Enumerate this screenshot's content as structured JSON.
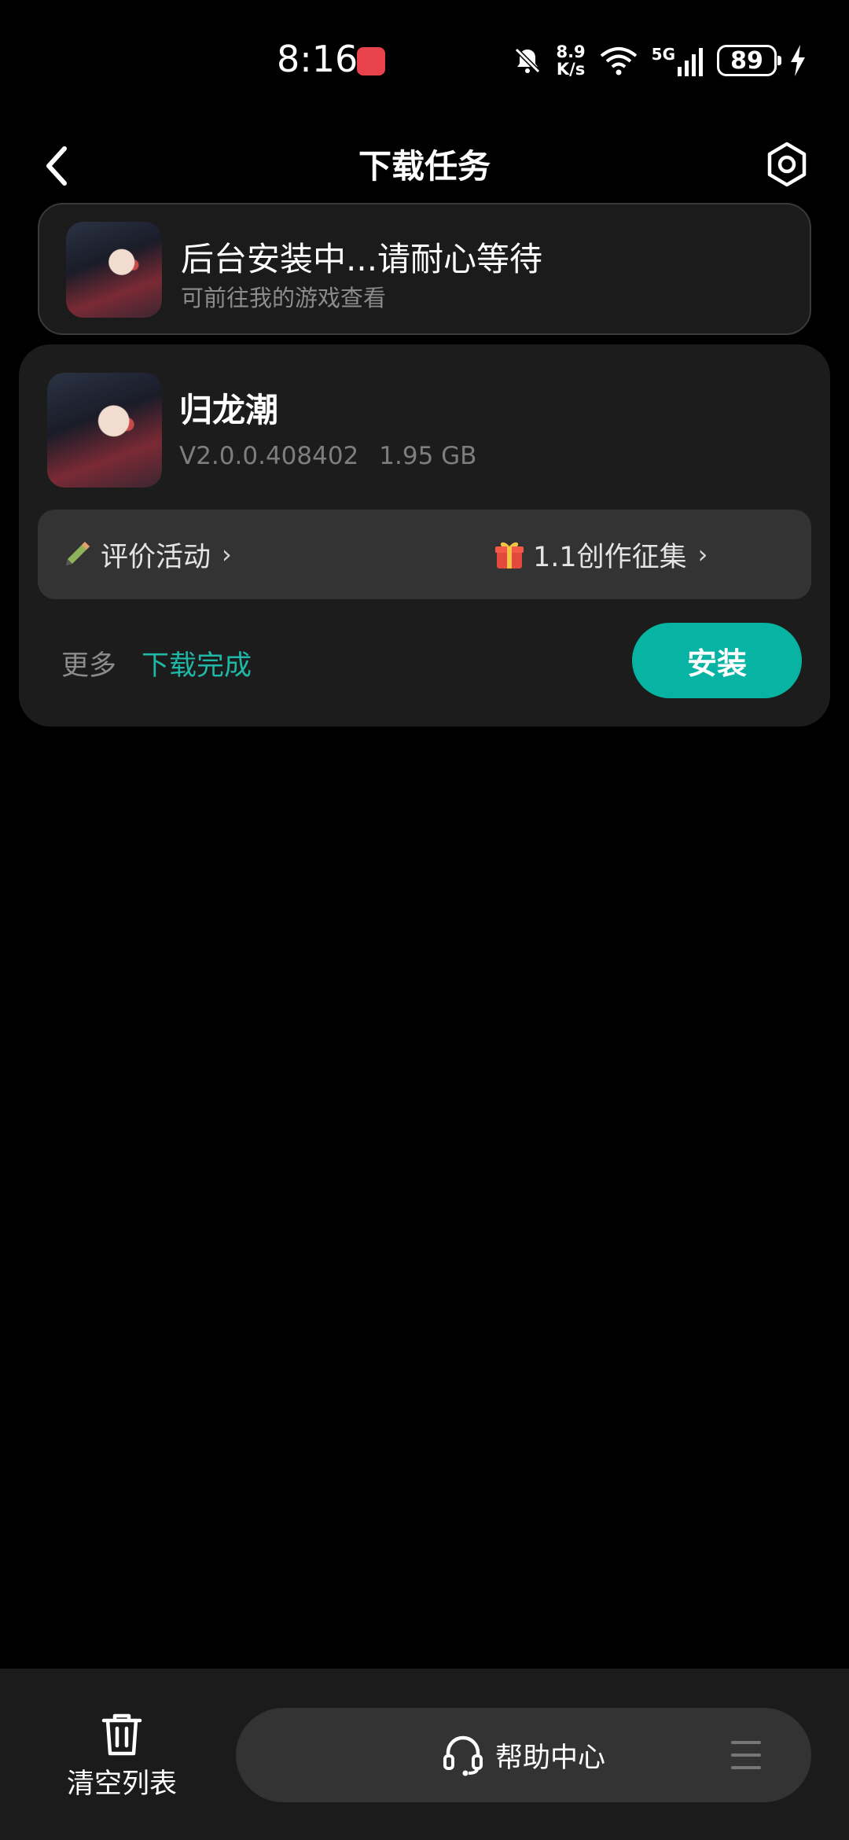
{
  "status_bar": {
    "time": "8:16",
    "network_speed_value": "8.9",
    "network_speed_unit": "K/s",
    "signal_type": "5G",
    "battery": "89",
    "icons": [
      "app-badge-icon",
      "mute-icon",
      "wifi-icon",
      "signal-icon",
      "battery-icon",
      "charging-icon"
    ]
  },
  "header": {
    "title": "下载任务",
    "back_icon": "back-chevron-icon",
    "settings_icon": "settings-hexagon-icon"
  },
  "banner": {
    "title": "后台安装中...请耐心等待",
    "subtitle": "可前往我的游戏查看"
  },
  "download_item": {
    "name": "归龙潮",
    "version": "V2.0.0.408402",
    "size": "1.95 GB",
    "activities": [
      {
        "label": "评价活动",
        "icon": "pencil-icon"
      },
      {
        "label": "1.1创作征集",
        "icon": "gift-icon"
      }
    ],
    "more_label": "更多",
    "status": "下载完成",
    "install_label": "安装",
    "accent_color": "#07b3a2"
  },
  "bottom_bar": {
    "clear_label": "清空列表",
    "help_label": "帮助中心",
    "icons": [
      "trash-icon",
      "headset-icon",
      "menu-icon"
    ]
  }
}
